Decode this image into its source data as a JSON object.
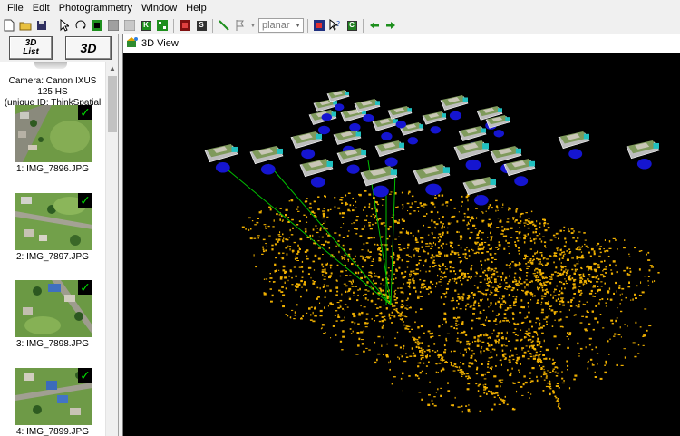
{
  "menubar": {
    "items": [
      "File",
      "Edit",
      "Photogrammetry",
      "Window",
      "Help"
    ]
  },
  "toolbar": {
    "box_labels": [
      "K",
      "S",
      "C"
    ],
    "mode_select": {
      "value": "planar"
    },
    "colors": {
      "green": "#1d8f1d",
      "red": "#b02020",
      "blue": "#2050c0"
    }
  },
  "left_panel": {
    "buttons": {
      "list_line1": "3D",
      "list_line2": "List",
      "view": "3D"
    },
    "camera_info": {
      "line1": "Camera: Canon IXUS 125 HS",
      "line2": "(unique ID: ThinkSpatial Ixus)"
    },
    "thumbnails": [
      {
        "label": "1: IMG_7896.JPG",
        "checked": true
      },
      {
        "label": "2: IMG_7897.JPG",
        "checked": true
      },
      {
        "label": "3: IMG_7898.JPG",
        "checked": true
      },
      {
        "label": "4: IMG_7899.JPG",
        "checked": true
      }
    ]
  },
  "view_window": {
    "title": "3D View",
    "colors": {
      "background": "#000000",
      "points": "#f0b000",
      "camera_base": "#1515d0",
      "ray": "#00c000"
    }
  }
}
